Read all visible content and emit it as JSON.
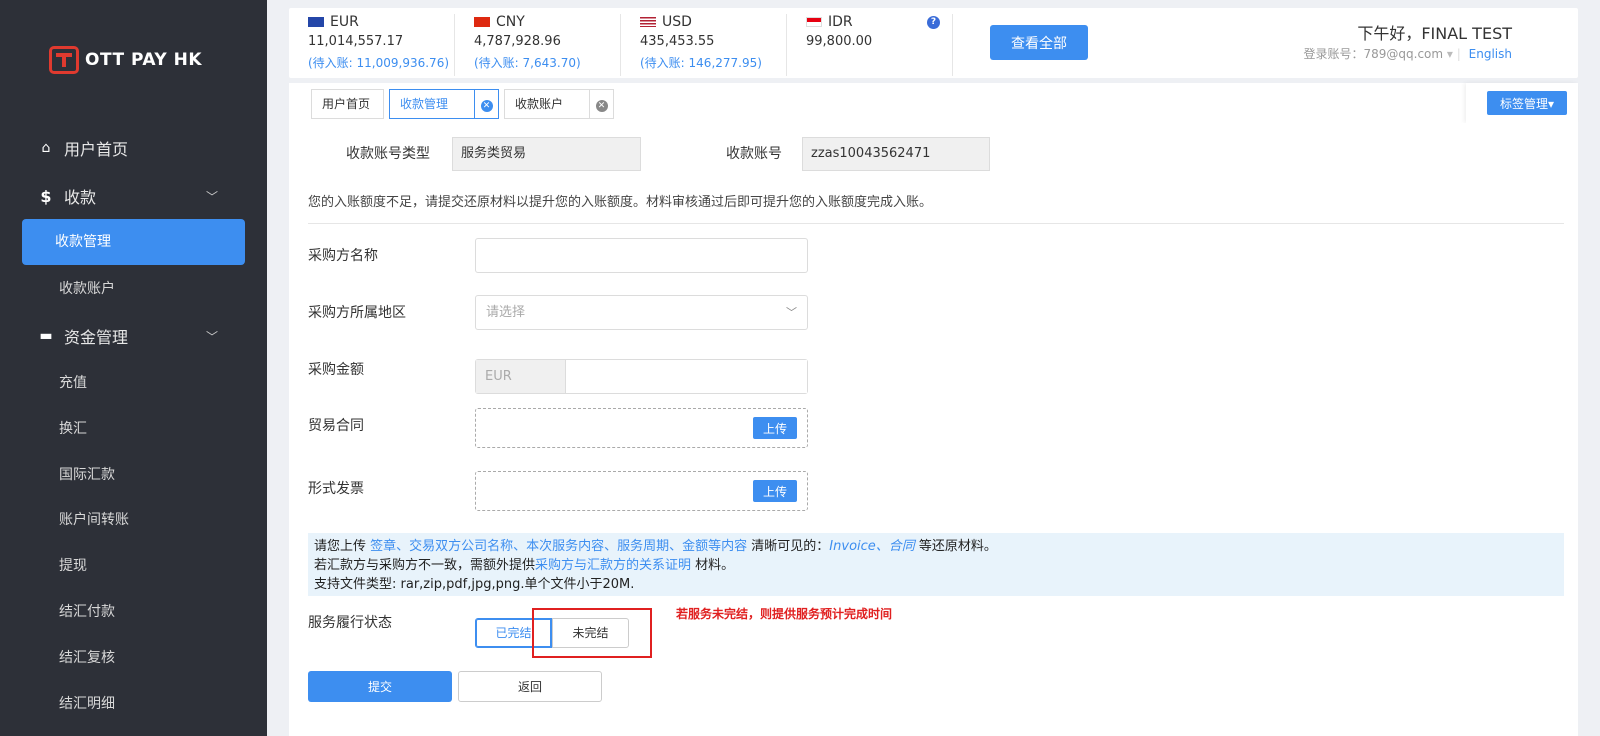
{
  "brand": {
    "logo_text": "OTT PAY HK",
    "accent": "#3d8ef0",
    "sidebar_bg": "#2d3038",
    "warning": "#e02020"
  },
  "sidebar": {
    "home": "用户首页",
    "collect": "收款",
    "collect_mgmt": "收款管理",
    "collect_account": "收款账户",
    "funds": "资金管理",
    "sub_items": [
      "充值",
      "换汇",
      "国际汇款",
      "账户间转账",
      "提现",
      "结汇付款",
      "结汇复核",
      "结汇明细"
    ]
  },
  "balances": [
    {
      "code": "EUR",
      "amount": "11,014,557.17",
      "pending": "(待入账: 11,009,936.76)"
    },
    {
      "code": "CNY",
      "amount": "4,787,928.96",
      "pending": "(待入账: 7,643.70)"
    },
    {
      "code": "USD",
      "amount": "435,453.55",
      "pending": "(待入账: 146,277.95)"
    },
    {
      "code": "IDR",
      "amount": "99,800.00",
      "pending": ""
    }
  ],
  "header": {
    "help": "?",
    "view_all": "查看全部",
    "greeting": "下午好，FINAL TEST",
    "account_label": "登录账号：789@qq.com",
    "language": "English"
  },
  "tabs": {
    "home": "用户首页",
    "collect_mgmt": "收款管理",
    "collect_account": "收款账户",
    "tag_mgmt": "标签管理▾"
  },
  "form": {
    "account_type_label": "收款账号类型",
    "account_type_value": "服务类贸易",
    "account_no_label": "收款账号",
    "account_no_value": "zzas10043562471",
    "notice": "您的入账额度不足，请提交还原材料以提升您的入账额度。材料审核通过后即可提升您的入账额度完成入账。",
    "buyer_name_label": "采购方名称",
    "buyer_name_value": "",
    "buyer_region_label": "采购方所属地区",
    "buyer_region_placeholder": "请选择",
    "amount_label": "采购金额",
    "amount_currency": "EUR",
    "amount_value": "",
    "contract_label": "贸易合同",
    "invoice_label": "形式发票",
    "upload": "上传",
    "tip_1a": "请您上传 ",
    "tip_1b": "签章、交易双方公司名称、本次服务内容、服务周期、金额等内容",
    "tip_1c": " 清晰可见的：",
    "tip_1d": "Invoice、合同",
    "tip_1e": " 等还原材料。",
    "tip_2a": "若汇款方与采购方不一致，需额外提供",
    "tip_2b": "采购方与汇款方的关系证明",
    "tip_2c": " 材料。",
    "tip_3": "支持文件类型: rar,zip,pdf,jpg,png.单个文件小于20M.",
    "status_label": "服务履行状态",
    "status_done": "已完结",
    "status_undone": "未完结",
    "status_hint": "若服务未完结，则提供服务预计完成时间",
    "submit": "提交",
    "back": "返回"
  }
}
